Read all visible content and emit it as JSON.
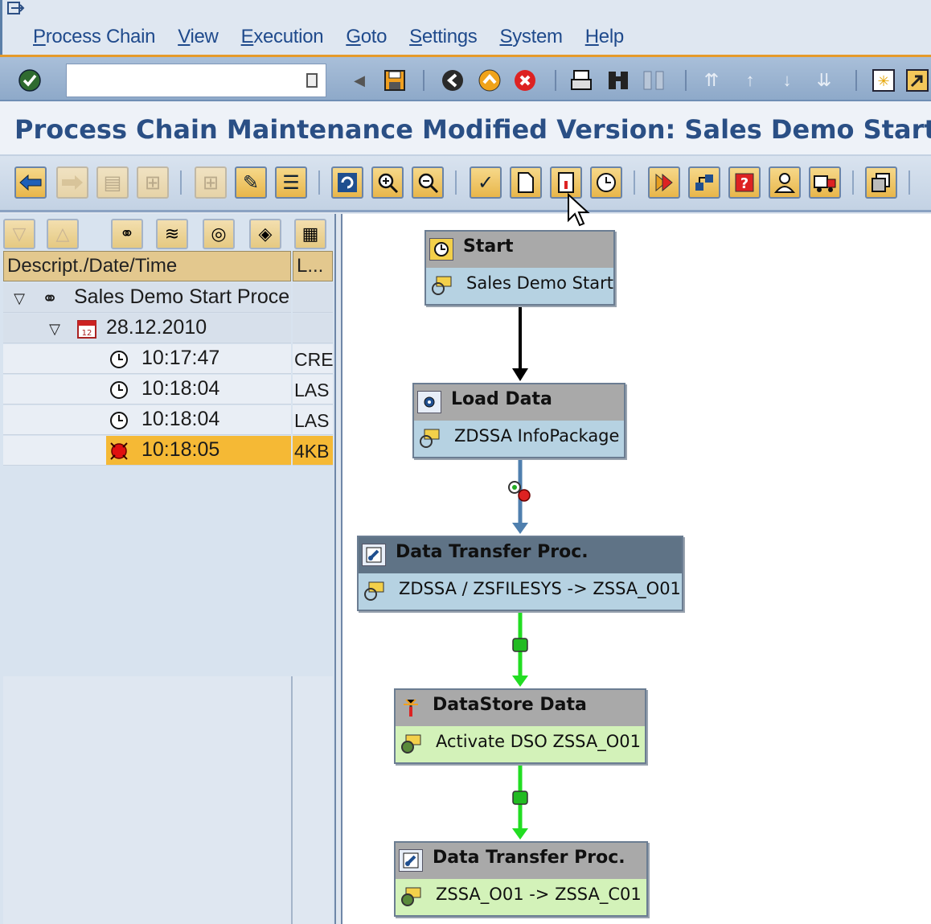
{
  "menu": {
    "items": [
      "Process Chain",
      "View",
      "Execution",
      "Goto",
      "Settings",
      "System",
      "Help"
    ]
  },
  "std_toolbar": {
    "command_value": "",
    "icons": [
      "enter-icon",
      "back-arrow-icon",
      "save-icon",
      "back-icon",
      "exit-icon",
      "cancel-icon",
      "print-icon",
      "find-icon",
      "find-next-icon",
      "first-page-icon",
      "previous-page-icon",
      "next-page-icon",
      "last-page-icon",
      "new-session-icon",
      "shortcut-icon"
    ]
  },
  "title": "Process Chain Maintenance Modified Version: Sales Demo Start",
  "tree": {
    "columns": [
      "Descript./Date/Time",
      "L..."
    ],
    "rows": [
      {
        "text": "Sales Demo Start Proce",
        "side": ""
      },
      {
        "text": "28.12.2010",
        "side": ""
      },
      {
        "text": "10:17:47",
        "side": "CRE."
      },
      {
        "text": "10:18:04",
        "side": "LAS"
      },
      {
        "text": "10:18:04",
        "side": "LAS"
      },
      {
        "text": "10:18:05",
        "side": "4KB"
      }
    ]
  },
  "diagram": {
    "nodes": [
      {
        "title": "Start",
        "subtitle": "Sales Demo Start",
        "style": "blue"
      },
      {
        "title": "Load Data",
        "subtitle": "ZDSSA InfoPackage",
        "style": "blue"
      },
      {
        "title": "Data Transfer Proc.",
        "subtitle": "ZDSSA / ZSFILESYS -> ZSSA_O01",
        "style": "blue-selected"
      },
      {
        "title": "DataStore Data",
        "subtitle": "Activate DSO ZSSA_O01",
        "style": "green"
      },
      {
        "title": "Data Transfer Proc.",
        "subtitle": "ZSSA_O01 -> ZSSA_C01",
        "style": "green"
      }
    ],
    "edges": [
      {
        "from": 0,
        "to": 1,
        "color": "#000000"
      },
      {
        "from": 1,
        "to": 2,
        "color": "#4f7fae"
      },
      {
        "from": 2,
        "to": 3,
        "color": "#22dd22"
      },
      {
        "from": 3,
        "to": 4,
        "color": "#22dd22"
      }
    ]
  },
  "colors": {
    "accent": "#2a4f85",
    "selection": "#f5b935",
    "edge_success": "#22dd22"
  }
}
